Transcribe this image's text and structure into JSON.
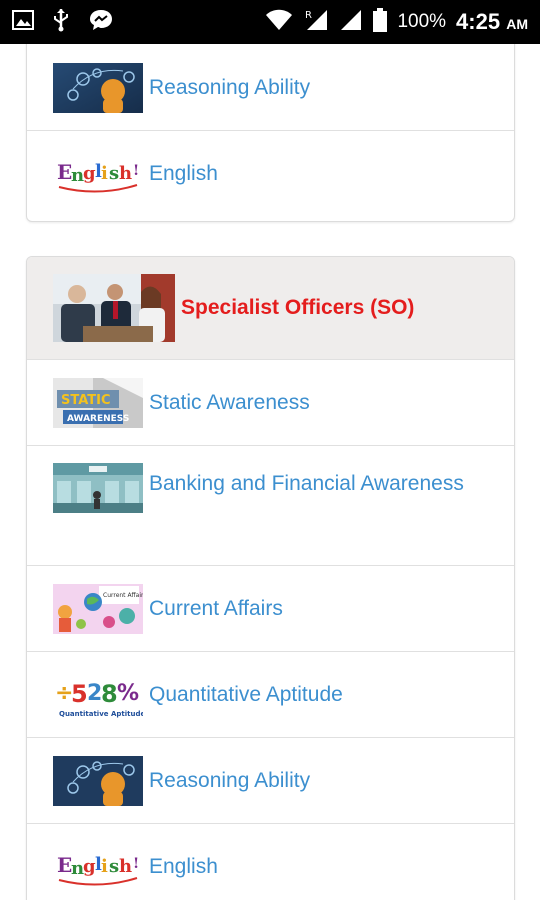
{
  "status_bar": {
    "battery": "100%",
    "time": "4:25",
    "ampm": "AM"
  },
  "top_card": {
    "items": [
      {
        "label": "Reasoning Ability",
        "icon": "reasoning-thumbnail"
      },
      {
        "label": "English",
        "icon": "english-thumbnail"
      }
    ]
  },
  "so_card": {
    "title": "Specialist Officers (SO)",
    "items": [
      {
        "label": "Static Awareness",
        "icon": "static-awareness-thumbnail"
      },
      {
        "label": "Banking and Financial Awareness",
        "icon": "banking-thumbnail"
      },
      {
        "label": "Current Affairs",
        "icon": "current-affairs-thumbnail"
      },
      {
        "label": "Quantitative Aptitude",
        "icon": "quantitative-aptitude-thumbnail"
      },
      {
        "label": "Reasoning Ability",
        "icon": "reasoning-thumbnail"
      },
      {
        "label": "English",
        "icon": "english-thumbnail"
      }
    ]
  },
  "colors": {
    "link": "#3c8fcf",
    "header_title": "#e41d1d",
    "header_bg": "#efedec"
  }
}
